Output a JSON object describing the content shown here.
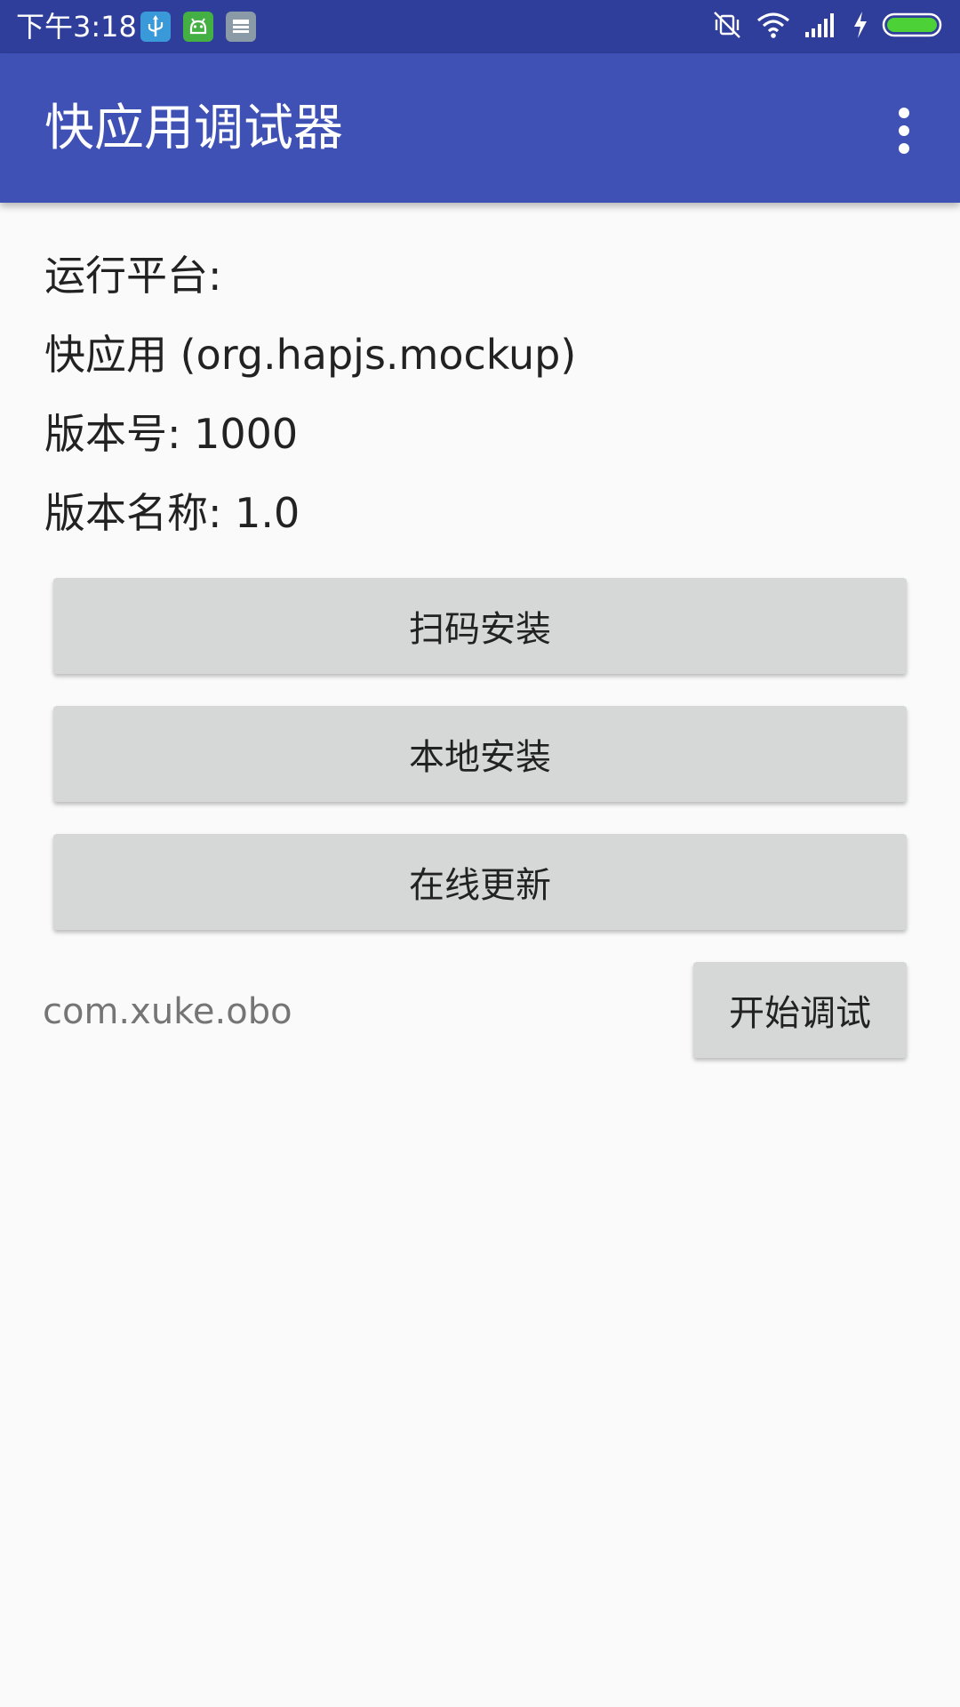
{
  "status_bar": {
    "time": "下午3:18",
    "notification_icons": [
      "usb-icon",
      "android-icon",
      "storage-icon"
    ],
    "status_icons": [
      "vibrate-icon",
      "wifi-icon",
      "signal-icon",
      "charging-icon",
      "battery-icon"
    ],
    "battery_level": 1.0
  },
  "app_bar": {
    "title": "快应用调试器",
    "menu_icon": "more-vert-icon"
  },
  "info": {
    "platform_label": "运行平台:",
    "platform_value": "快应用 (org.hapjs.mockup)",
    "version_code": "版本号: 1000",
    "version_name": "版本名称: 1.0"
  },
  "buttons": {
    "scan_install": "扫码安装",
    "local_install": "本地安装",
    "online_update": "在线更新",
    "start_debug": "开始调试"
  },
  "package_input": {
    "value": "com.xuke.obo"
  },
  "colors": {
    "status_bar": "#2f3e9b",
    "app_bar": "#3f51b5",
    "background": "#fafafa",
    "button": "#d6d7d7",
    "battery": "#4cd137"
  }
}
